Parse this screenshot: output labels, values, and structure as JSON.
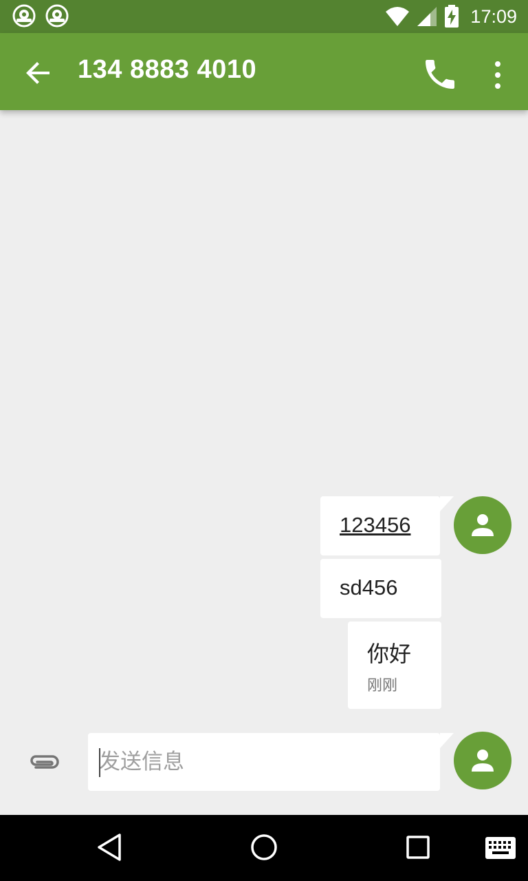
{
  "status_bar": {
    "time": "17:09",
    "left_icons": [
      "notification-app-icon",
      "notification-app-icon"
    ],
    "right_icons": [
      "wifi-icon",
      "cell-signal-icon",
      "battery-charging-icon"
    ]
  },
  "app_bar": {
    "title": "134 8883 4010",
    "back_icon": "arrow-back-icon",
    "call_icon": "phone-icon",
    "menu_icon": "more-vert-icon"
  },
  "messages": [
    {
      "text": "123456"
    },
    {
      "text": "sd456"
    },
    {
      "text": "你好",
      "timestamp": "刚刚"
    }
  ],
  "compose": {
    "placeholder": "发送信息",
    "value": "",
    "attach_icon": "paperclip-icon",
    "avatar_icon": "person-icon"
  },
  "nav_bar": {
    "icons": [
      "nav-back-icon",
      "nav-home-icon",
      "nav-recents-icon",
      "keyboard-icon"
    ]
  },
  "colors": {
    "status_bar": "#548330",
    "app_bar": "#689f38",
    "avatar": "#689f38",
    "background": "#eeeeee",
    "bubble": "#ffffff"
  }
}
